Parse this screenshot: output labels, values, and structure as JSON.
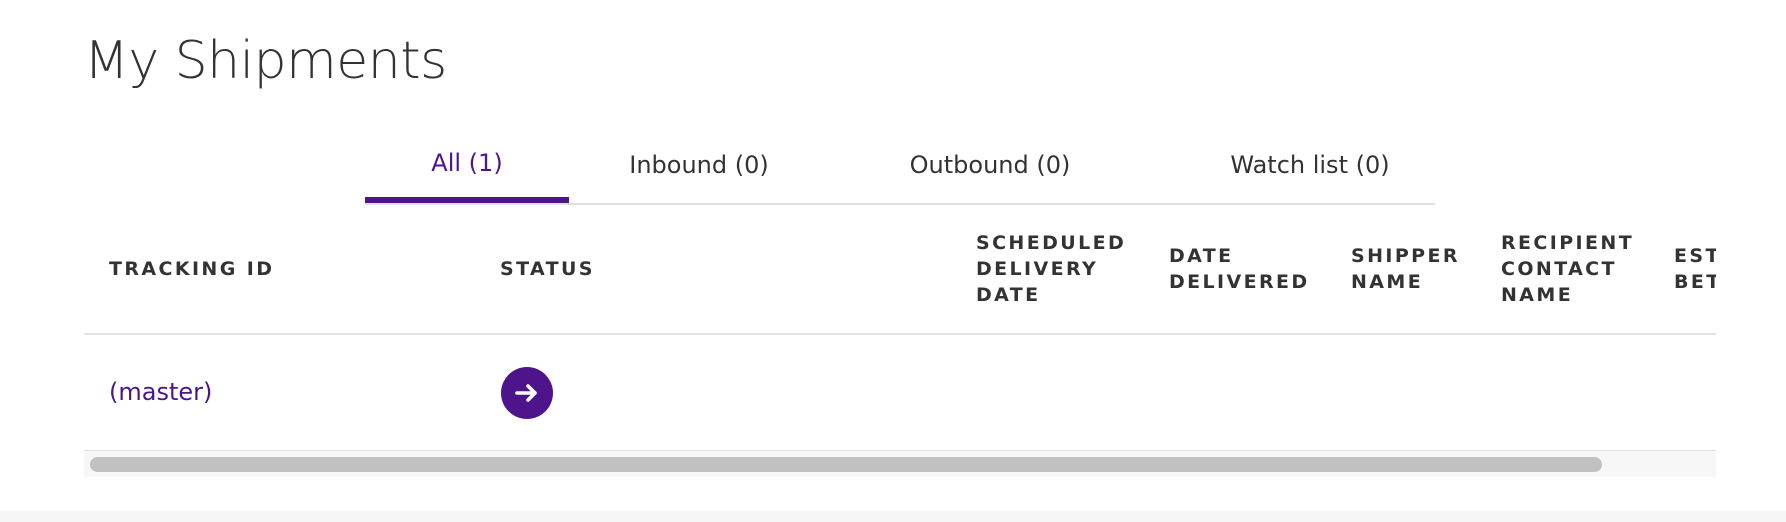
{
  "page": {
    "title": "My Shipments"
  },
  "tabs": [
    {
      "label": "All (1)",
      "active": true
    },
    {
      "label": "Inbound (0)",
      "active": false
    },
    {
      "label": "Outbound (0)",
      "active": false
    },
    {
      "label": "Watch list (0)",
      "active": false
    }
  ],
  "table": {
    "columns": [
      "TRACKING ID",
      "STATUS",
      "SCHEDULED\nDELIVERY\nDATE",
      "DATE\nDELIVERED",
      "SHIPPER\nNAME",
      "RECIPIENT\nCONTACT\nNAME",
      "EST\nBET"
    ],
    "rows": [
      {
        "tracking_id": "(master)",
        "status_icon": "arrow-right-icon"
      }
    ]
  },
  "colors": {
    "accent": "#4d148c",
    "text": "#333333",
    "divider": "#e3e3e3",
    "scrollbar_thumb": "#c1c1c1"
  }
}
